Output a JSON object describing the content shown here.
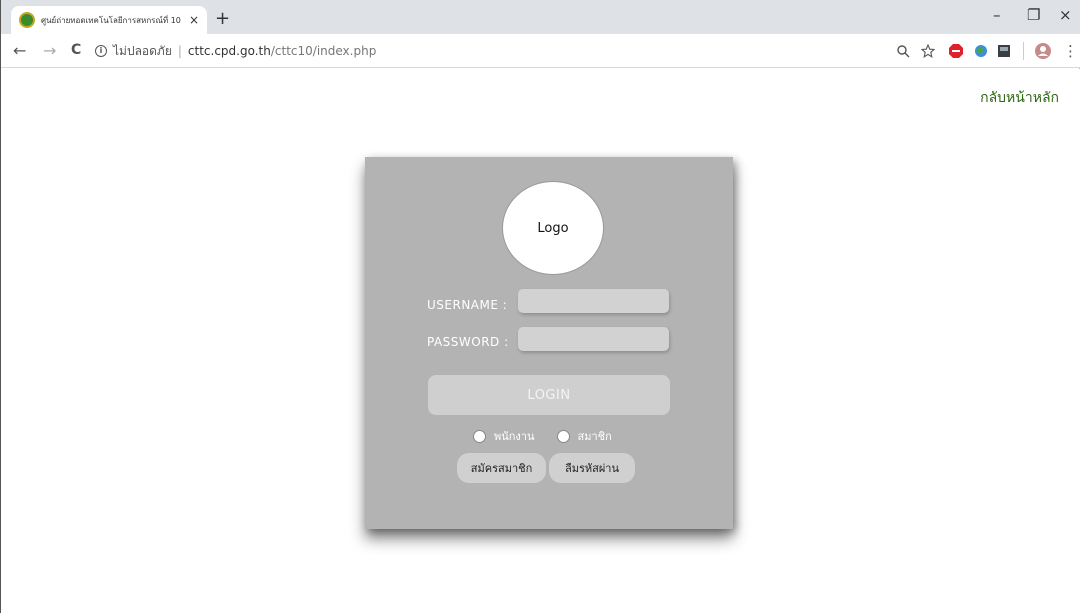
{
  "browser": {
    "tab_title": "ศูนย์ถ่ายทอดเทคโนโลยีการสหกรณ์ที่ 10",
    "tab_close": "×",
    "new_tab": "+",
    "minimize": "–",
    "maximize": "❐",
    "close": "×",
    "back": "←",
    "forward": "→",
    "reload": "C",
    "security_label": "ไม่ปลอดภัย",
    "url_domain": "cttc.cpd.go.th",
    "url_path": "/cttc10/index.php",
    "menu": "⋮"
  },
  "page": {
    "home_link": "กลับหน้าหลัก",
    "logo_text": "Logo",
    "username_label": "USERNAME :",
    "password_label": "PASSWORD :",
    "username_value": "",
    "password_value": "",
    "login_label": "LOGIN",
    "radio_staff": "พนักงาน",
    "radio_member": "สมาชิก",
    "register_label": "สมัครสมาชิก",
    "forgot_label": "ลืมรหัสผ่าน"
  },
  "colors": {
    "card": "#b3b3b3",
    "home_link": "#2c6a12",
    "tab_strip": "#dee1e6"
  }
}
